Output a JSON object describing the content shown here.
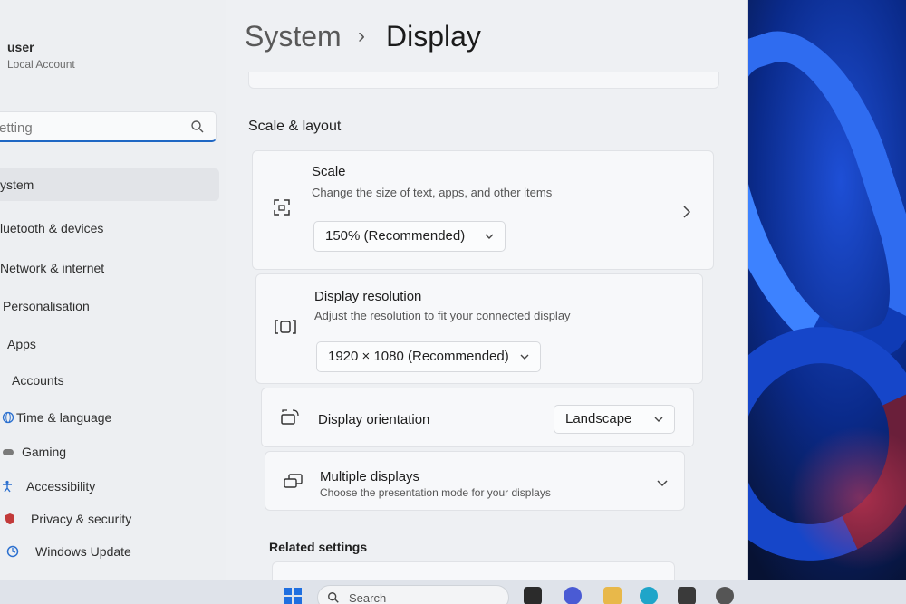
{
  "sidebar": {
    "user_name": "user",
    "user_type": "Local Account",
    "search_placeholder": "etting",
    "items": [
      {
        "label": "ystem",
        "icon": "system-icon",
        "active": true
      },
      {
        "label": "luetooth & devices",
        "icon": "bluetooth-icon"
      },
      {
        "label": "Network & internet",
        "icon": "network-icon"
      },
      {
        "label": "Personalisation",
        "icon": "brush-icon"
      },
      {
        "label": "Apps",
        "icon": "apps-icon"
      },
      {
        "label": "Accounts",
        "icon": "person-icon"
      },
      {
        "label": "Time & language",
        "icon": "globe-icon"
      },
      {
        "label": "Gaming",
        "icon": "gamepad-icon"
      },
      {
        "label": "Accessibility",
        "icon": "accessibility-icon"
      },
      {
        "label": "Privacy & security",
        "icon": "shield-icon"
      },
      {
        "label": "Windows Update",
        "icon": "update-icon"
      }
    ]
  },
  "header": {
    "crumb_parent": "System",
    "crumb_separator": "›",
    "crumb_current": "Display"
  },
  "main": {
    "section_title": "Scale & layout",
    "scale": {
      "title": "Scale",
      "subtitle": "Change the size of text, apps, and other items",
      "value": "150% (Recommended)"
    },
    "resolution": {
      "title": "Display resolution",
      "subtitle": "Adjust the resolution to fit your connected display",
      "value": "1920 × 1080 (Recommended)"
    },
    "orientation": {
      "title": "Display orientation",
      "value": "Landscape"
    },
    "multiple": {
      "title": "Multiple displays",
      "subtitle": "Choose the presentation mode for your displays"
    },
    "related_title": "Related settings"
  },
  "taskbar": {
    "search_label": "Search"
  },
  "colors": {
    "accent": "#1f67c4",
    "window_bg": "#eef0f3",
    "card_bg": "#f7f8fa"
  }
}
